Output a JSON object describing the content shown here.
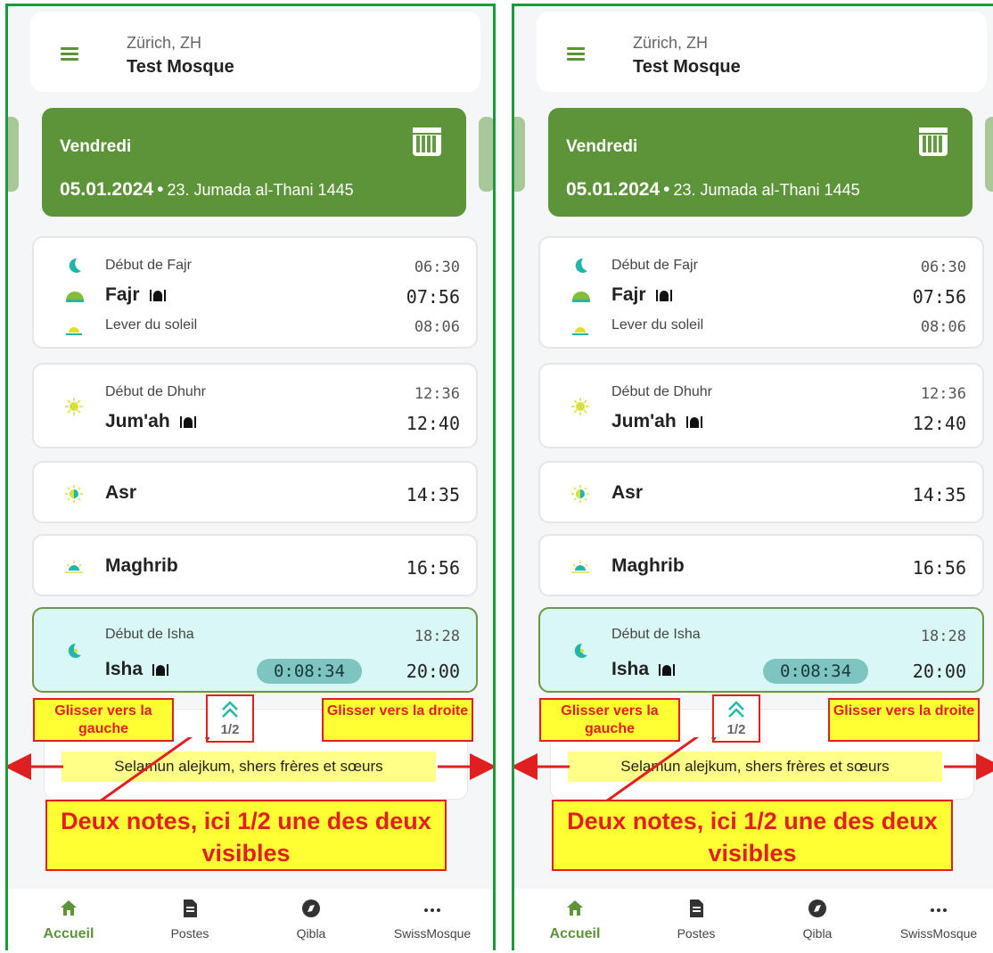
{
  "header": {
    "city": "Zürich, ZH",
    "mosque": "Test Mosque"
  },
  "date": {
    "weekday": "Vendredi",
    "gregorian": "05.01.2024",
    "separator": "•",
    "hijri": "23. Jumada al-Thani 1445"
  },
  "prayers": {
    "fajr": {
      "start_label": "Début de Fajr",
      "start_time": "06:30",
      "name": "Fajr",
      "time": "07:56",
      "sunrise_label": "Lever du soleil",
      "sunrise_time": "08:06"
    },
    "dhuhr": {
      "start_label": "Début de Dhuhr",
      "start_time": "12:36",
      "name": "Jum'ah",
      "time": "12:40"
    },
    "asr": {
      "name": "Asr",
      "time": "14:35"
    },
    "maghrib": {
      "name": "Maghrib",
      "time": "16:56"
    },
    "isha": {
      "start_label": "Début de Isha",
      "start_time": "18:28",
      "name": "Isha",
      "time": "20:00",
      "countdown": "0:08:34"
    }
  },
  "notes": {
    "pager": "1/2",
    "greeting": "Selamun alejkum, shers frères et sœurs"
  },
  "annotations": {
    "swipe_left": "Glisser vers la gauche",
    "swipe_right": "Glisser vers la droite",
    "explanation": "Deux notes, ici 1/2 une des deux visibles"
  },
  "nav": {
    "home": "Accueil",
    "posts": "Postes",
    "qibla": "Qibla",
    "more": "SwissMosque"
  },
  "colors": {
    "brand_green": "#5d943a",
    "active_card": "#d9f8f5",
    "countdown_pill": "#7ec4c0",
    "annotation_red": "#e02020",
    "annotation_yellow": "#ffff33"
  }
}
